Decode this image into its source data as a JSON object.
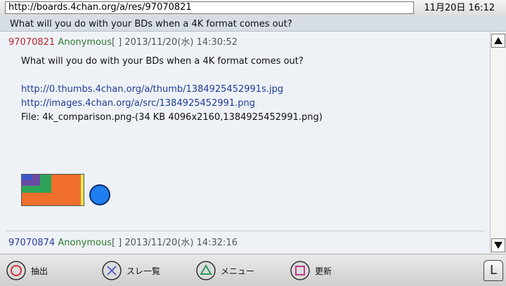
{
  "browser": {
    "url": "http://boards.4chan.org/a/res/97070821",
    "clock": "11月20日 16:12"
  },
  "thread": {
    "title": "What will you do with your BDs when a 4K format comes out?"
  },
  "posts": [
    {
      "number": "97070821",
      "name": "Anonymous",
      "flag": "[ ]",
      "date": "2013/11/20(水) 14:30:52",
      "text": "What will you do with your BDs when a 4K format comes out?",
      "links": [
        "http://0.thumbs.4chan.org/a/thumb/1384925452991s.jpg",
        "http://images.4chan.org/a/src/1384925452991.png"
      ],
      "file": "File: 4k_comparison.png-(34 KB 4096x2160,1384925452991.png)"
    },
    {
      "number": "97070874",
      "name": "Anonymous",
      "flag": "[ ]",
      "date": "2013/11/20(水) 14:32:16"
    }
  ],
  "controls": {
    "circle_label": "抽出",
    "cross_label": "スレ一覧",
    "triangle_label": "メニュー",
    "square_label": "更新",
    "l_label": "L"
  },
  "colors": {
    "post_number_first": "#b8262b",
    "post_number_second": "#2a3a9e",
    "name": "#2f7a2f",
    "link": "#1f3b96"
  }
}
